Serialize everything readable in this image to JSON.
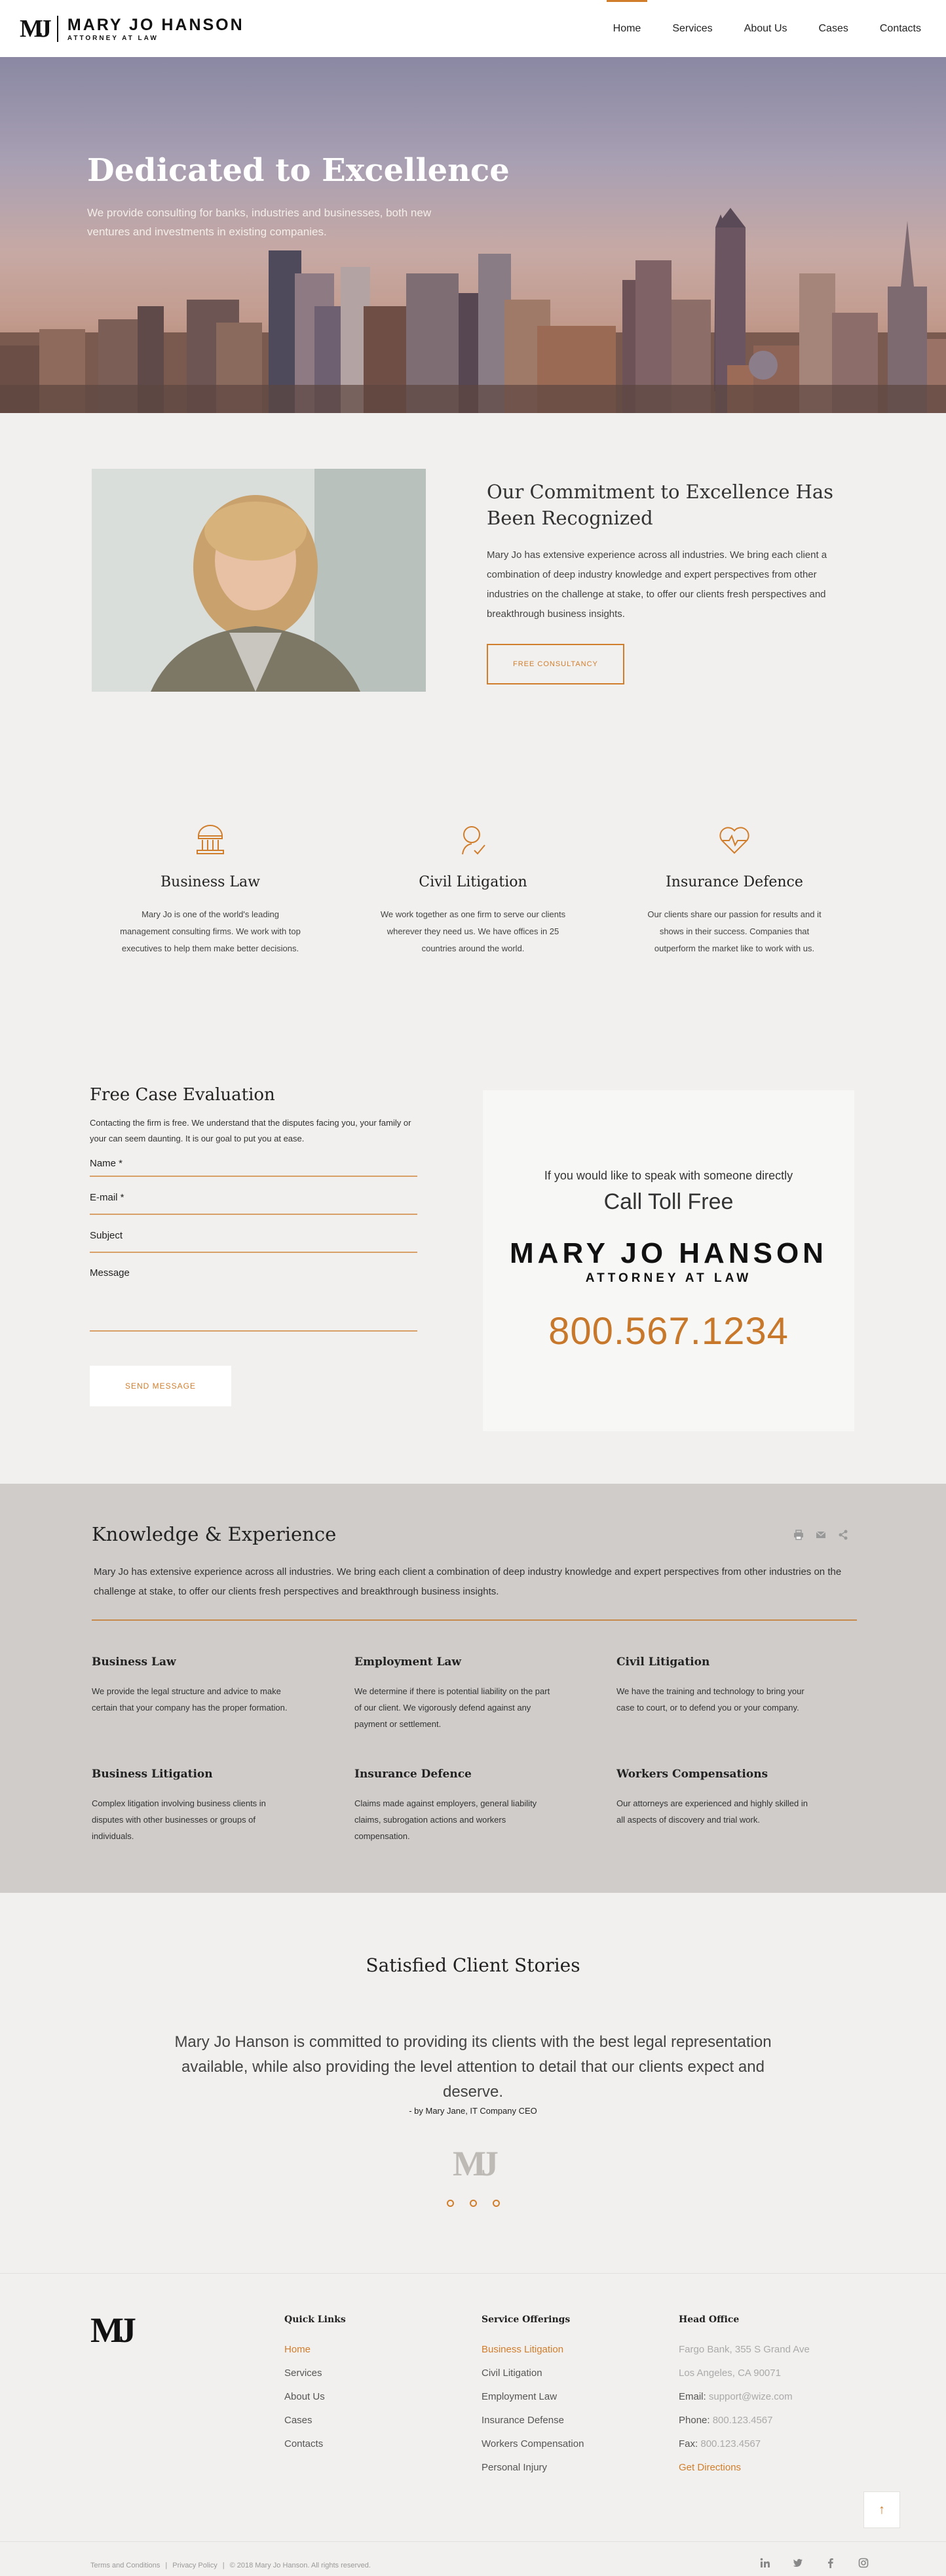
{
  "header": {
    "logo_mark": "MJ",
    "logo_name": "MARY JO HANSON",
    "logo_sub": "ATTORNEY AT LAW",
    "nav": [
      "Home",
      "Services",
      "About Us",
      "Cases",
      "Contacts"
    ]
  },
  "hero": {
    "title": "Dedicated to Excellence",
    "text": "We provide consulting for banks, industries and businesses, both new ventures and investments in existing companies."
  },
  "commitment": {
    "title": "Our Commitment to Excellence Has Been Recognized",
    "body": "Mary Jo has extensive experience across all industries. We bring each client a combination of deep industry knowledge and expert perspectives from other industries on the challenge at stake, to offer our clients fresh perspectives and breakthrough business insights.",
    "button": "FREE CONSULTANCY"
  },
  "services": [
    {
      "title": "Business Law",
      "body": "Mary Jo is one of the world's leading management consulting firms. We work with top executives to help them make better decisions.",
      "icon": "bank-icon"
    },
    {
      "title": "Civil Litigation",
      "body": "We work together as one firm to serve our clients wherever they need us. We have offices in 25 countries around the world.",
      "icon": "person-check-icon"
    },
    {
      "title": "Insurance Defence",
      "body": "Our clients share our passion for results and it shows in their success. Companies that outperform the market like to work with us.",
      "icon": "heart-pulse-icon"
    }
  ],
  "case": {
    "title": "Free Case Evaluation",
    "intro": "Contacting the firm is free. We understand that the disputes facing you, your family or your can seem daunting. It is our goal to put you at ease.",
    "fields": {
      "name": "Name *",
      "email": "E-mail *",
      "subject": "Subject",
      "message": "Message"
    },
    "button": "SEND MESSAGE",
    "call_small": "If you would like to speak with someone directly",
    "call_big": "Call Toll Free",
    "call_name": "MARY JO HANSON",
    "call_sub": "ATTORNEY AT LAW",
    "phone": "800.567.1234"
  },
  "knowledge": {
    "title": "Knowledge & Experience",
    "intro": "Mary Jo has extensive experience across all industries. We bring each client a combination of deep industry knowledge and expert perspectives from other industries on the challenge at stake, to offer our clients fresh perspectives and breakthrough business insights.",
    "items": [
      {
        "title": "Business Law",
        "body": "We provide the legal structure and advice to make certain that your company has the proper formation."
      },
      {
        "title": "Employment Law",
        "body": "We determine if there is potential liability on the part of our client. We vigorously defend against any payment or settlement."
      },
      {
        "title": "Civil Litigation",
        "body": "We have the training and technology to bring your case to court, or to defend you or your company."
      },
      {
        "title": "Business Litigation",
        "body": "Complex litigation involving business clients in disputes with other businesses or groups of individuals."
      },
      {
        "title": "Insurance Defence",
        "body": "Claims made against employers, general liability claims, subrogation actions and workers compensation."
      },
      {
        "title": "Workers Compensations",
        "body": "Our attorneys are experienced and highly skilled in all aspects of discovery and trial work."
      }
    ]
  },
  "testimonial": {
    "title": "Satisfied Client Stories",
    "quote": "Mary Jo Hanson is committed to providing its clients with the best legal representation available, while also providing the level attention to detail that our clients expect and deserve.",
    "author": "- by Mary Jane, IT Company CEO",
    "mark": "MJ"
  },
  "footer": {
    "logo": "MJ",
    "quick_title": "Quick Links",
    "quick": [
      "Home",
      "Services",
      "About Us",
      "Cases",
      "Contacts"
    ],
    "service_title": "Service Offerings",
    "service_links": [
      "Business Litigation",
      "Civil Litigation",
      "Employment Law",
      "Insurance Defense",
      "Workers Compensation",
      "Personal Injury"
    ],
    "office_title": "Head Office",
    "address1": "Fargo Bank, 355 S Grand Ave",
    "address2": "Los Angeles, CA 90071",
    "email_label": "Email:",
    "email": "support@wize.com",
    "phone_label": "Phone:",
    "phone": "800.123.4567",
    "fax_label": "Fax:",
    "fax": "800.123.4567",
    "directions": "Get Directions",
    "to_top": "↑",
    "terms": "Terms and Conditions",
    "privacy": "Privacy Policy",
    "copyright": "© 2018 Mary Jo Hanson. All rights reserved."
  },
  "colors": {
    "accent": "#d17e2c",
    "knowledge_bg": "#d0ccca"
  }
}
